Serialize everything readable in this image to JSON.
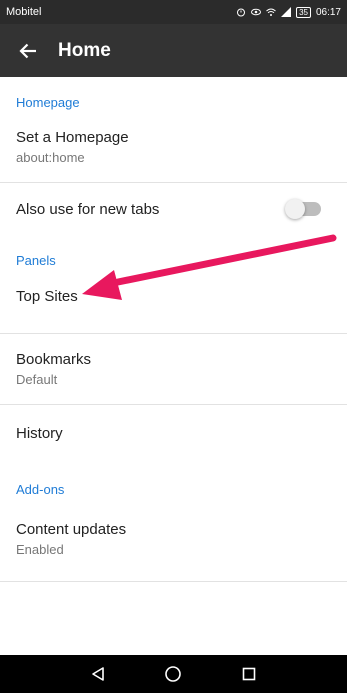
{
  "status_bar": {
    "carrier": "Mobitel",
    "battery": "35",
    "time": "06:17"
  },
  "toolbar": {
    "title": "Home",
    "back_icon": "arrow-back-icon"
  },
  "sections": {
    "homepage": {
      "header": "Homepage",
      "set_homepage": {
        "title": "Set a Homepage",
        "value": "about:home"
      },
      "new_tabs": {
        "title": "Also use for new tabs",
        "enabled": false
      }
    },
    "panels": {
      "header": "Panels",
      "top_sites": {
        "title": "Top Sites"
      },
      "bookmarks": {
        "title": "Bookmarks",
        "value": "Default"
      },
      "history": {
        "title": "History"
      }
    },
    "addons": {
      "header": "Add-ons",
      "content_updates": {
        "title": "Content updates",
        "value": "Enabled"
      }
    }
  },
  "colors": {
    "accent": "#1f7cd6",
    "toolbar": "#333333",
    "annotation": "#e8185e"
  },
  "nav_bar": {
    "icons": [
      "back-triangle-icon",
      "home-circle-icon",
      "recents-square-icon"
    ]
  }
}
